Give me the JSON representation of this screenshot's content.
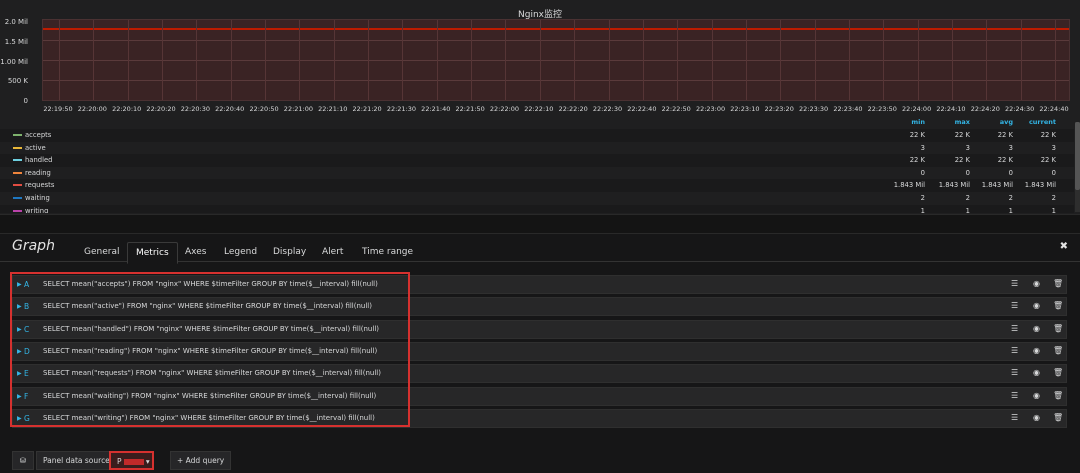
{
  "graph": {
    "title": "Nginx监控",
    "y_ticks": [
      "2.0 Mil",
      "1.5 Mil",
      "1.00 Mil",
      "500 K",
      "0"
    ],
    "x_ticks": [
      "22:19:50",
      "22:20:00",
      "22:20:10",
      "22:20:20",
      "22:20:30",
      "22:20:40",
      "22:20:50",
      "22:21:00",
      "22:21:10",
      "22:21:20",
      "22:21:30",
      "22:21:40",
      "22:21:50",
      "22:22:00",
      "22:22:10",
      "22:22:20",
      "22:22:30",
      "22:22:40",
      "22:22:50",
      "22:23:00",
      "22:23:10",
      "22:23:20",
      "22:23:30",
      "22:23:40",
      "22:23:50",
      "22:24:00",
      "22:24:10",
      "22:24:20",
      "22:24:30",
      "22:24:40"
    ],
    "legend_headers": {
      "min": "min",
      "max": "max",
      "avg": "avg",
      "current": "current"
    },
    "legend": [
      {
        "name": "accepts",
        "color": "#7eb26d",
        "min": "22 K",
        "max": "22 K",
        "avg": "22 K",
        "current": "22 K"
      },
      {
        "name": "active",
        "color": "#eab839",
        "min": "3",
        "max": "3",
        "avg": "3",
        "current": "3"
      },
      {
        "name": "handled",
        "color": "#6ed0e0",
        "min": "22 K",
        "max": "22 K",
        "avg": "22 K",
        "current": "22 K"
      },
      {
        "name": "reading",
        "color": "#ef843c",
        "min": "0",
        "max": "0",
        "avg": "0",
        "current": "0"
      },
      {
        "name": "requests",
        "color": "#e24d42",
        "min": "1.843 Mil",
        "max": "1.843 Mil",
        "avg": "1.843 Mil",
        "current": "1.843 Mil"
      },
      {
        "name": "waiting",
        "color": "#1f78c1",
        "min": "2",
        "max": "2",
        "avg": "2",
        "current": "2"
      },
      {
        "name": "writing",
        "color": "#ba43a9",
        "min": "1",
        "max": "1",
        "avg": "1",
        "current": "1"
      }
    ]
  },
  "editor": {
    "title": "Graph",
    "tabs": [
      {
        "label": "General",
        "active": false
      },
      {
        "label": "Metrics",
        "active": true
      },
      {
        "label": "Axes",
        "active": false
      },
      {
        "label": "Legend",
        "active": false
      },
      {
        "label": "Display",
        "active": false
      },
      {
        "label": "Alert",
        "active": false
      },
      {
        "label": "Time range",
        "active": false
      }
    ],
    "close_icon": "close-icon",
    "queries": [
      {
        "ref": "A",
        "text": "SELECT mean(\"accepts\") FROM \"nginx\" WHERE $timeFilter GROUP BY time($__interval) fill(null)"
      },
      {
        "ref": "B",
        "text": "SELECT mean(\"active\") FROM \"nginx\" WHERE $timeFilter GROUP BY time($__interval) fill(null)"
      },
      {
        "ref": "C",
        "text": "SELECT mean(\"handled\") FROM \"nginx\" WHERE $timeFilter GROUP BY time($__interval) fill(null)"
      },
      {
        "ref": "D",
        "text": "SELECT mean(\"reading\") FROM \"nginx\" WHERE $timeFilter GROUP BY time($__interval) fill(null)"
      },
      {
        "ref": "E",
        "text": "SELECT mean(\"requests\") FROM \"nginx\" WHERE $timeFilter GROUP BY time($__interval) fill(null)"
      },
      {
        "ref": "F",
        "text": "SELECT mean(\"waiting\") FROM \"nginx\" WHERE $timeFilter GROUP BY time($__interval) fill(null)"
      },
      {
        "ref": "G",
        "text": "SELECT mean(\"writing\") FROM \"nginx\" WHERE $timeFilter GROUP BY time($__interval) fill(null)"
      }
    ],
    "footer": {
      "panel_data_source_label": "Panel data source",
      "datasource_value": "P",
      "add_query_label": "+ Add query"
    }
  },
  "colors": {
    "accent": "#33b5e5",
    "series_line": "#bf1b00",
    "highlight": "#d6312f"
  }
}
